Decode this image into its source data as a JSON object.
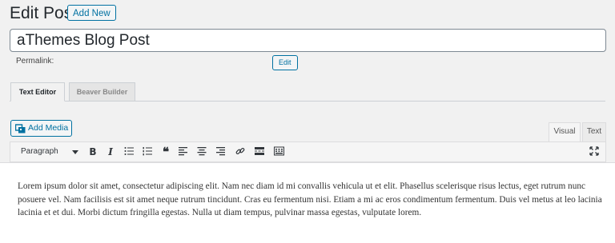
{
  "header": {
    "title": "Edit Post",
    "add_new_label": "Add New"
  },
  "post": {
    "title": "aThemes Blog Post",
    "permalink_label": "Permalink:",
    "permalink_edit_label": "Edit"
  },
  "builder_tabs": [
    {
      "label": "Text Editor",
      "active": true
    },
    {
      "label": "Beaver Builder",
      "active": false
    }
  ],
  "media": {
    "add_media_label": "Add Media",
    "icon": "media-icon"
  },
  "editor_modes": {
    "visual": "Visual",
    "text": "Text",
    "active": "visual"
  },
  "toolbar": {
    "format_value": "Paragraph",
    "buttons": [
      "bold",
      "italic",
      "bulleted-list",
      "numbered-list",
      "blockquote",
      "align-left",
      "align-center",
      "align-right",
      "link",
      "read-more",
      "toolbar-toggle",
      "fullscreen"
    ]
  },
  "content": {
    "paragraph": "Lorem ipsum dolor sit amet, consectetur adipiscing elit. Nam nec diam id mi convallis vehicula ut et elit. Phasellus scelerisque risus lectus, eget rutrum nunc posuere vel. Nam facilisis est sit amet neque rutrum tincidunt. Cras eu fermentum nisi. Etiam a mi ac eros condimentum fermentum. Duis vel metus at leo lacinia lacinia et et dui. Morbi dictum fringilla egestas. Nulla ut diam tempus, pulvinar massa egestas, vulputate lorem."
  },
  "colors": {
    "accent": "#0071a1",
    "background": "#f1f1f1",
    "text": "#23282d"
  }
}
